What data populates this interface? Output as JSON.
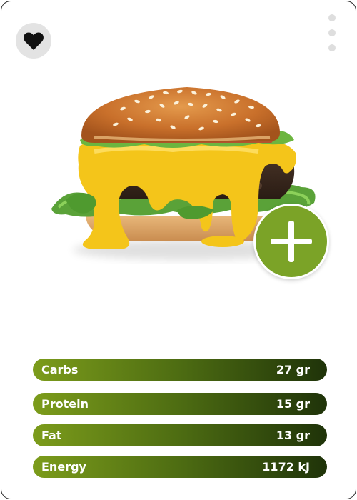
{
  "product": {
    "name": "",
    "image": "cheeseburger"
  },
  "icons": {
    "favorite": "heart-icon",
    "more": "more-vertical-icon",
    "add": "plus-icon"
  },
  "colors": {
    "accent": "#7ba327",
    "bar_start": "#7c9c1b",
    "bar_end": "#1f3309",
    "favorite_bg": "#e3e3e3"
  },
  "nutrition": [
    {
      "label": "Carbs",
      "value": "27 gr"
    },
    {
      "label": "Protein",
      "value": "15 gr"
    },
    {
      "label": "Fat",
      "value": "13 gr"
    },
    {
      "label": "Energy",
      "value": "1172 kJ"
    }
  ]
}
